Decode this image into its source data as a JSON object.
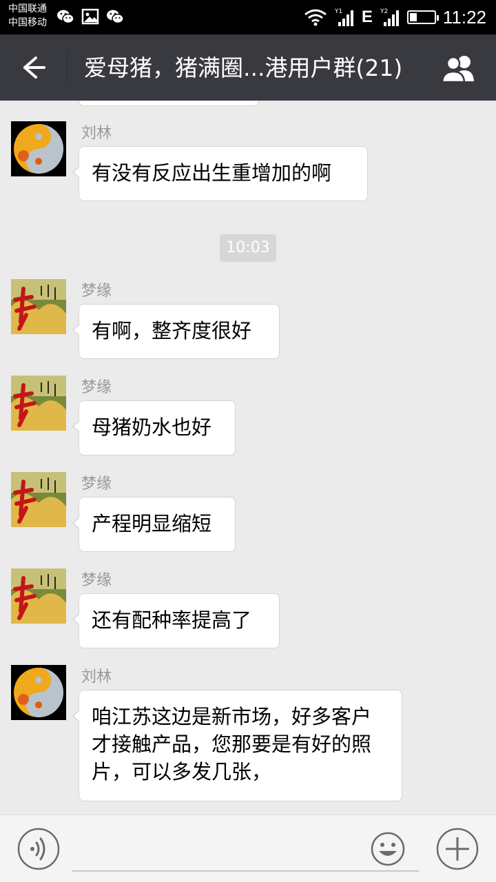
{
  "status_bar": {
    "carrier_1": "中国联通",
    "carrier_2": "中国移动",
    "time": "11:22",
    "network": "E",
    "battery_level": 0.3,
    "left_icons": [
      "wechat-icon",
      "image-icon",
      "wechat-icon"
    ],
    "right_icons": [
      "wifi-icon",
      "signal-sim1-icon",
      "signal-sim2-icon",
      "battery-icon"
    ]
  },
  "header": {
    "title": "爱母猪，猪满圈...港用户群(21)",
    "back_icon": "arrow-left-icon",
    "members_icon": "group-members-icon"
  },
  "chat": {
    "timestamp": "10:03",
    "messages": [
      {
        "sender": "刘林",
        "text": "有没有反应出生重增加的啊",
        "avatar": "yin-yang-avatar"
      },
      {
        "sender": "梦缘",
        "text": "有啊，整齐度很好",
        "avatar": "calligraphy-avatar"
      },
      {
        "sender": "梦缘",
        "text": "母猪奶水也好",
        "avatar": "calligraphy-avatar"
      },
      {
        "sender": "梦缘",
        "text": "产程明显缩短",
        "avatar": "calligraphy-avatar"
      },
      {
        "sender": "梦缘",
        "text": "还有配种率提高了",
        "avatar": "calligraphy-avatar"
      },
      {
        "sender": "刘林",
        "text": "咱江苏这边是新市场，好多客户才接触产品，您那要是有好的照片，可以多发几张，",
        "avatar": "yin-yang-avatar"
      }
    ]
  },
  "input_bar": {
    "voice_icon": "voice-input-icon",
    "emoji_icon": "emoji-icon",
    "plus_icon": "plus-icon",
    "text": ""
  },
  "colors": {
    "title_bar": "#393a3f",
    "chat_background": "#ebebeb",
    "bubble": "#ffffff",
    "sender_name": "#999999"
  }
}
